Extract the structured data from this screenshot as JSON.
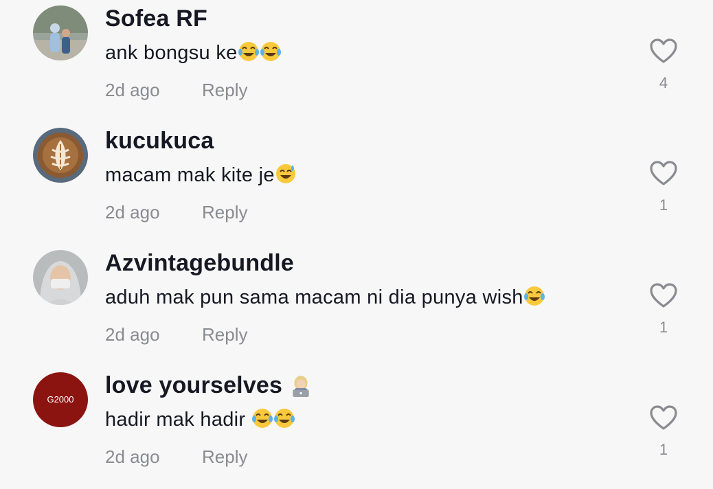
{
  "comments": [
    {
      "username": "Sofea RF",
      "text": "ank bongsu ke",
      "emoji": [
        "joy",
        "joy"
      ],
      "time": "2d ago",
      "reply": "Reply",
      "likes": "4",
      "liked_icon": "heart-outline-icon"
    },
    {
      "username": "kucukuca",
      "text": "macam mak kite je",
      "emoji": [
        "sweat-smile"
      ],
      "time": "2d ago",
      "reply": "Reply",
      "likes": "1",
      "liked_icon": "heart-outline-icon"
    },
    {
      "username": "Azvintagebundle",
      "text": "aduh mak pun sama macam ni dia punya wish",
      "emoji": [
        "joy"
      ],
      "time": "2d ago",
      "reply": "Reply",
      "likes": "1",
      "liked_icon": "heart-outline-icon"
    },
    {
      "username": "love yourselves",
      "username_emoji": [
        "woman-technologist"
      ],
      "text": "hadir mak hadir ",
      "emoji": [
        "joy",
        "joy"
      ],
      "time": "2d ago",
      "reply": "Reply",
      "likes": "1",
      "liked_icon": "heart-outline-icon"
    }
  ],
  "avatar4_logo": "G2000",
  "colors": {
    "background": "#f7f7f7",
    "username": "#161823",
    "meta": "#8a8b91"
  }
}
